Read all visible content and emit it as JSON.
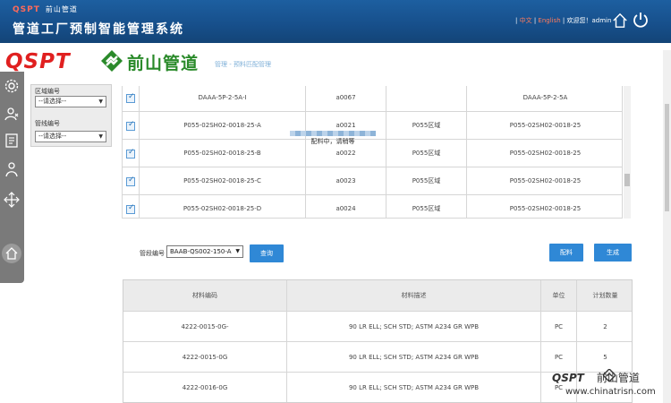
{
  "header": {
    "logo_text": "QSPT",
    "logo_sub": "前山管道",
    "title": "管道工厂预制智能管理系统",
    "lang": "中文",
    "sep1": " | ",
    "lang2": "English",
    "sep2": " | ",
    "welcome": "欢迎您！admin",
    "sep3": " | "
  },
  "brand": {
    "qspt": "QSPT",
    "name": "前山管道",
    "breadcrumb": "管理 - 预料匹配管理"
  },
  "filter": {
    "area_label": "区域编号",
    "area_value": "--请选择--",
    "pipeline_label": "管线编号",
    "pipeline_value": "--请选择--"
  },
  "upper_table": {
    "rows": [
      {
        "code": "DAAA-5P-2-5A-I",
        "id": "a0067",
        "area": "",
        "pipe": "DAAA-5P-2-5A"
      },
      {
        "code": "P055-02SH02-0018-25-A",
        "id": "a0021",
        "area": "P055区域",
        "pipe": "P055-02SH02-0018-25"
      },
      {
        "code": "P055-02SH02-0018-25-B",
        "id": "a0022",
        "area": "P055区域",
        "pipe": "P055-02SH02-0018-25"
      },
      {
        "code": "P055-02SH02-0018-25-C",
        "id": "a0023",
        "area": "P055区域",
        "pipe": "P055-02SH02-0018-25"
      },
      {
        "code": "P055-02SH02-0018-25-D",
        "id": "a0024",
        "area": "P055区域",
        "pipe": "P055-02SH02-0018-25"
      }
    ],
    "loading_text": "配料中，请稍等"
  },
  "search": {
    "label": "管段编号",
    "value": "BAAB-QS002-150-A",
    "query_button": "查询",
    "match_button": "配料",
    "generate_button": "生成"
  },
  "lower_table": {
    "headers": [
      "材料编码",
      "材料描述",
      "单位",
      "计划数量"
    ],
    "rows": [
      {
        "code": "4222-0015-0G-",
        "desc": "90 LR ELL; SCH STD; ASTM A234 GR WPB",
        "unit": "PC",
        "qty": "2"
      },
      {
        "code": "4222-0015-0G",
        "desc": "90 LR ELL; SCH STD; ASTM A234 GR WPB",
        "unit": "PC",
        "qty": "5"
      },
      {
        "code": "4222-0016-0G",
        "desc": "90 LR ELL; SCH STD; ASTM A234 GR WPB",
        "unit": "PC",
        "qty": ""
      }
    ]
  },
  "watermark": {
    "brand": "QSPT",
    "brand_cn": "前山管道",
    "url": "www.chinatrisn.com"
  },
  "colors": {
    "header_blue": "#17508c",
    "button_blue": "#2f88d6",
    "logo_red": "#e02020",
    "brand_green": "#2a8a2a"
  }
}
